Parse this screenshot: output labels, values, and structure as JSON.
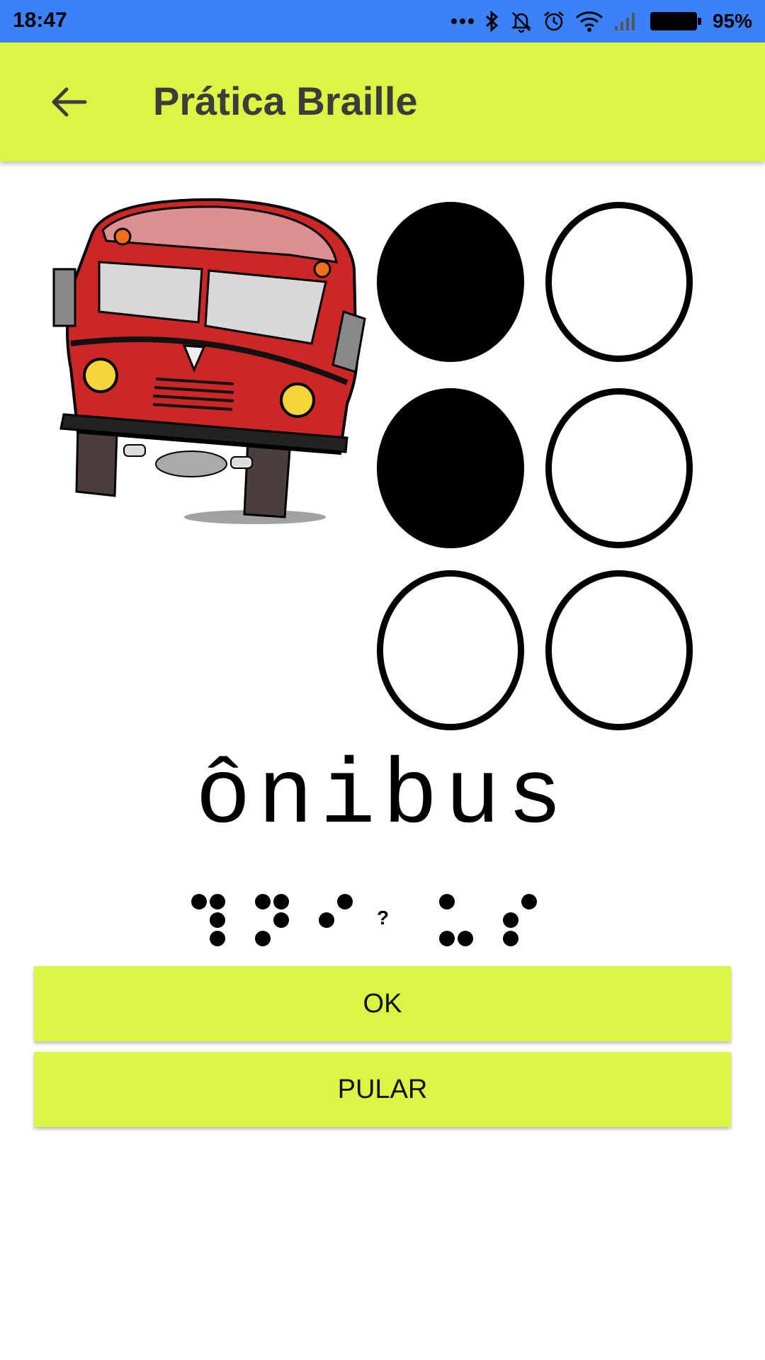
{
  "status_bar": {
    "time": "18:47",
    "battery_percent": "95%",
    "icons": [
      "more-dots-icon",
      "bluetooth-icon",
      "notifications-off-icon",
      "alarm-icon",
      "wifi-icon",
      "signal-icon",
      "battery-icon"
    ]
  },
  "app_bar": {
    "title": "Prática Braille",
    "back_icon": "arrow-back-icon",
    "background": "#dcf443"
  },
  "exercise": {
    "image_icon": "bus-illustration",
    "braille_cell": {
      "dots_filled": [
        1,
        2
      ],
      "dots_empty": [
        3,
        4,
        5,
        6
      ]
    },
    "word": "ônibus",
    "braille_transcription_unknown_char": "?"
  },
  "buttons": {
    "ok_label": "OK",
    "skip_label": "PULAR"
  },
  "colors": {
    "status_bar": "#3a82f6",
    "accent": "#dcf443"
  }
}
